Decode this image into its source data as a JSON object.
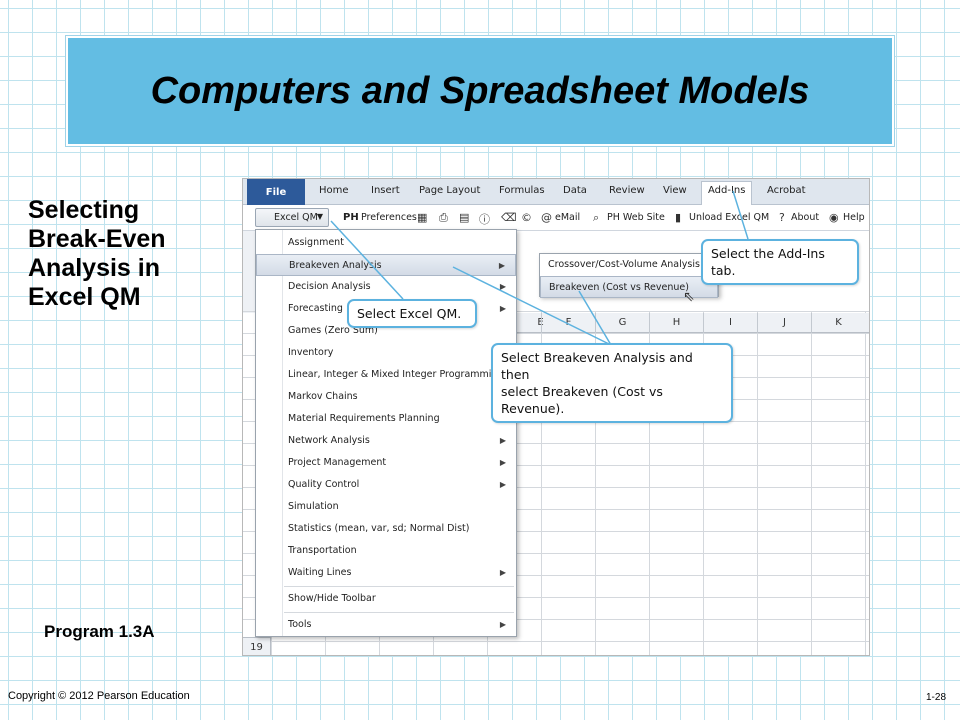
{
  "slide": {
    "title": "Computers and Spreadsheet Models",
    "side_lines": [
      "Selecting",
      "Break-Even",
      "Analysis in",
      "Excel QM"
    ],
    "program_label": "Program 1.3A",
    "copyright": "Copyright © 2012 Pearson Education",
    "page_number": "1-28"
  },
  "ribbon": {
    "tabs": [
      "File",
      "Home",
      "Insert",
      "Page Layout",
      "Formulas",
      "Data",
      "Review",
      "View",
      "Add-Ins",
      "Acrobat"
    ]
  },
  "toolbar": {
    "excel_qm": "Excel QM",
    "ph": "PH",
    "preferences": "Preferences",
    "email": "eMail",
    "ph_web_site": "PH Web Site",
    "unload": "Unload Excel QM",
    "about": "About",
    "help": "Help"
  },
  "menu": {
    "items": [
      "Assignment",
      "Breakeven Analysis",
      "Decision Analysis",
      "Forecasting",
      "Games (Zero Sum)",
      "Inventory",
      "Linear, Integer & Mixed Integer Programming",
      "Markov Chains",
      "Material Requirements Planning",
      "Network Analysis",
      "Project Management",
      "Quality Control",
      "Simulation",
      "Statistics (mean, var, sd; Normal Dist)",
      "Transportation",
      "Waiting Lines",
      "Show/Hide Toolbar",
      "Tools"
    ],
    "submenu": [
      "Crossover/Cost-Volume Analysis",
      "Breakeven (Cost vs Revenue)"
    ]
  },
  "sheet": {
    "columns": [
      "E",
      "F",
      "G",
      "H",
      "I",
      "J",
      "K"
    ],
    "row_number": "19"
  },
  "callouts": {
    "addins": "Select the Add-Ins tab.",
    "excelqm": "Select Excel QM.",
    "breakeven": [
      "Select Breakeven Analysis and then",
      "select Breakeven (Cost vs Revenue)."
    ]
  },
  "colors": {
    "title_bg": "#63bde3",
    "callout_border": "#5cb2df",
    "file_tab": "#2d5a9a"
  }
}
